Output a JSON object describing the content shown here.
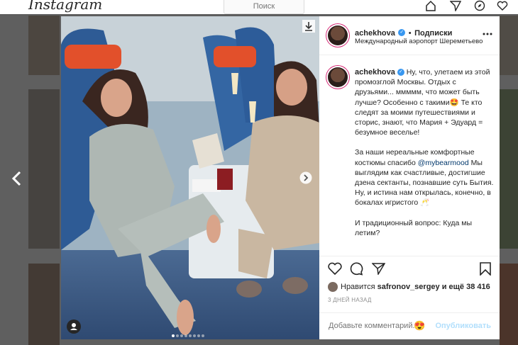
{
  "app": {
    "logo": "Instagram",
    "search_placeholder": "Поиск"
  },
  "post": {
    "author": "achekhova",
    "follow_label": "Подписки",
    "separator": "•",
    "location": "Международный аэропорт Шереметьево",
    "caption_paragraphs": [
      "Ну, что, улетаем из этой промозглой Москвы. Отдых с друзьями... ммммм, что может быть лучше? Особенно с такими🤩 Те кто следят за моими путешествиями и сторис, знают, что Мария + Эдуард = безумное веселье!",
      "За наши нереальные комфортные костюмы спасибо",
      "Мы выглядим как счастливые, достигшие дзена сектанты, познавшие суть Бытия. Ну, и истина нам открылась, конечно, в бокалах игристого 🥂",
      "И традиционный вопрос: Куда мы летим?"
    ],
    "mention": "@mybearmood",
    "liked_prefix": "Нравится",
    "liked_user": "safronov_sergey",
    "liked_suffix": "и ещё 38 416",
    "date": "3 ДНЕЙ НАЗАД",
    "comment_placeholder": "Добавьте комментарий...",
    "publish_label": "Опубликовать",
    "carousel": {
      "total": 8,
      "active": 1
    }
  },
  "colors": {
    "accent": "#3897f0",
    "story_ring": "#d62976",
    "publish_disabled": "#b2dffc"
  }
}
